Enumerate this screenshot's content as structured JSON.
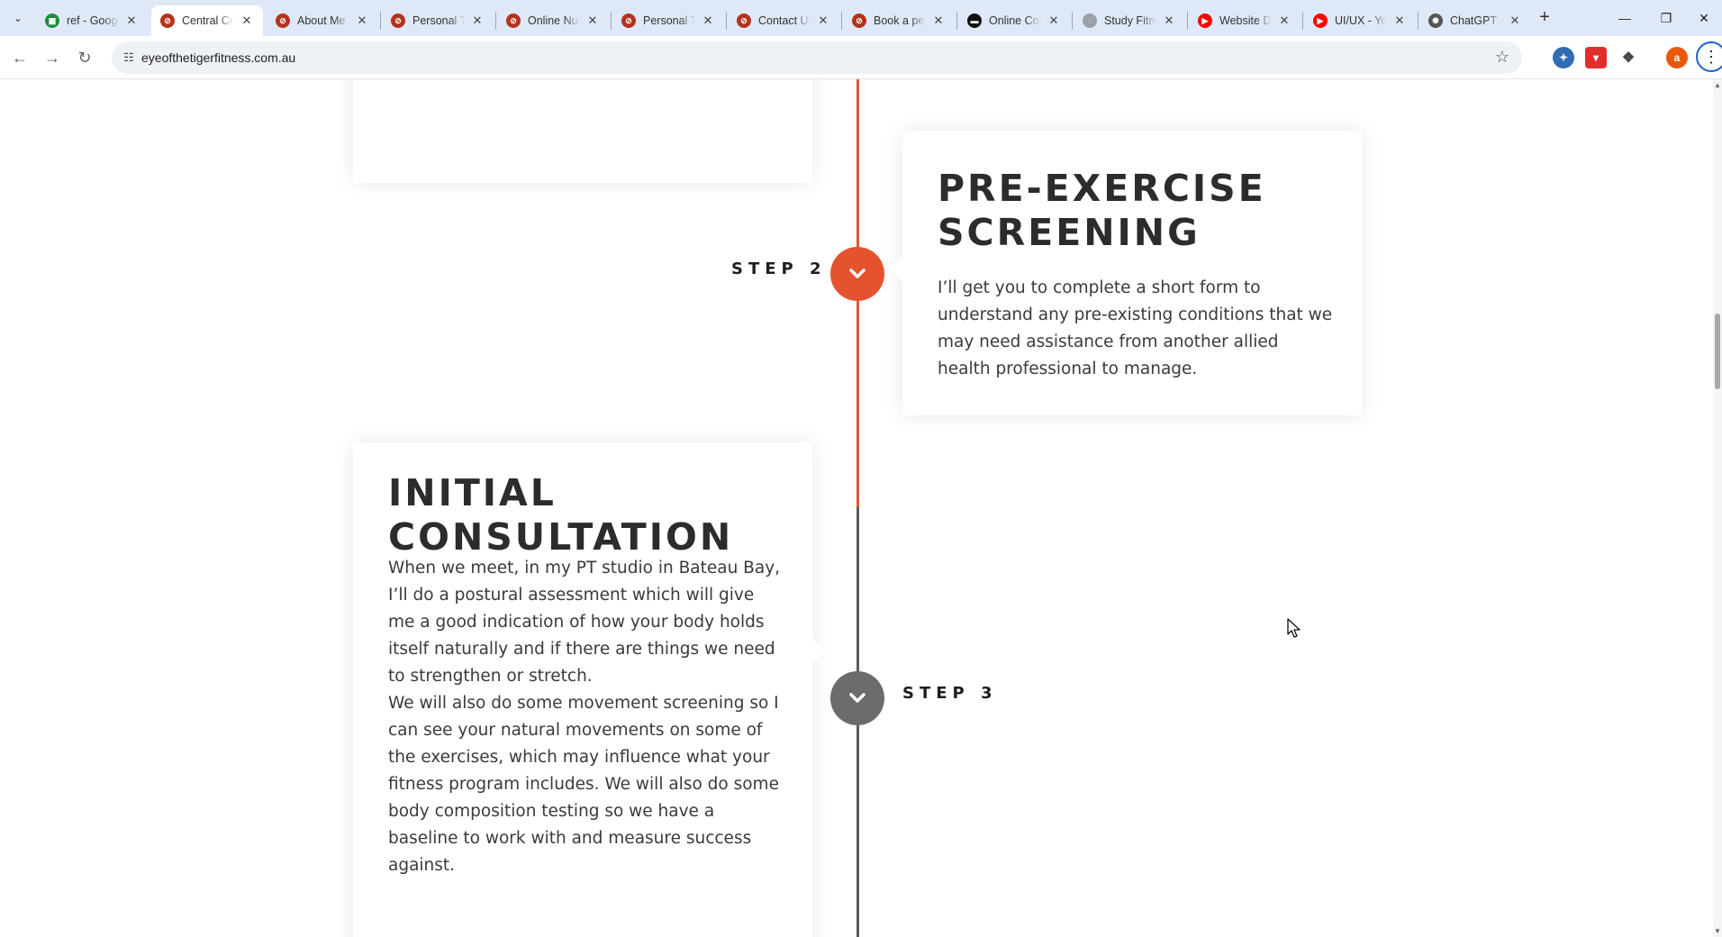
{
  "browser": {
    "tabs": [
      {
        "title": "ref - Google Sheets",
        "icon": "sheets-icon",
        "color": "#1e8e3e",
        "glyph": "▦"
      },
      {
        "title": "Central Coast Personal Trainer",
        "icon": "eye-of-tiger-icon",
        "color": "#b3331c",
        "glyph": "⊘"
      },
      {
        "title": "About Me",
        "icon": "eye-of-tiger-icon",
        "color": "#b3331c",
        "glyph": "⊘"
      },
      {
        "title": "Personal Training",
        "icon": "eye-of-tiger-icon",
        "color": "#b3331c",
        "glyph": "⊘"
      },
      {
        "title": "Online Nutrition",
        "icon": "eye-of-tiger-icon",
        "color": "#b3331c",
        "glyph": "⊘"
      },
      {
        "title": "Personal Training",
        "icon": "eye-of-tiger-icon",
        "color": "#b3331c",
        "glyph": "⊘"
      },
      {
        "title": "Contact Us",
        "icon": "eye-of-tiger-icon",
        "color": "#b3331c",
        "glyph": "⊘"
      },
      {
        "title": "Book a personal",
        "icon": "eye-of-tiger-icon",
        "color": "#b3331c",
        "glyph": "⊘"
      },
      {
        "title": "Online Coaching",
        "icon": "site-dark-icon",
        "color": "#111111",
        "glyph": "▬"
      },
      {
        "title": "Study Fitness",
        "icon": "study-fitness-icon",
        "color": "#9aa0a6",
        "glyph": "◌"
      },
      {
        "title": "Website Design",
        "icon": "youtube-icon",
        "color": "#ff0000",
        "glyph": "▶"
      },
      {
        "title": "UI/UX - YouTube",
        "icon": "youtube-icon",
        "color": "#ff0000",
        "glyph": "▶"
      },
      {
        "title": "ChatGPT",
        "icon": "chatgpt-icon",
        "color": "#555555",
        "glyph": "✺"
      }
    ],
    "active_tab_index": 1,
    "url": "eyeofthetigerfitness.com.au",
    "profile_initial": "a"
  },
  "page": {
    "step2": {
      "label": "STEP 2",
      "title_line1": "PRE-EXERCISE",
      "title_line2": "SCREENING",
      "body": "I’ll get you to complete a short form to understand any pre-existing conditions that we may need assistance from another allied health professional to manage."
    },
    "step3": {
      "label": "STEP 3",
      "title_line1": "INITIAL",
      "title_line2": "CONSULTATION",
      "body1": "When we meet, in my PT studio in Bateau Bay, I’ll do a postural assessment which will give me a good indication of how your body holds itself naturally and if there are things we need to strengthen or stretch.",
      "body2": "We will also do some movement screening so I can see your natural movements on some of the exercises, which may influence what your fitness program includes. We will also do some body composition testing so we have a baseline to work with and measure success against."
    },
    "colors": {
      "accent": "#e4532e",
      "inactive": "#6b6b6b",
      "heading": "#2c2c2c",
      "text": "#3a3a3a"
    }
  }
}
